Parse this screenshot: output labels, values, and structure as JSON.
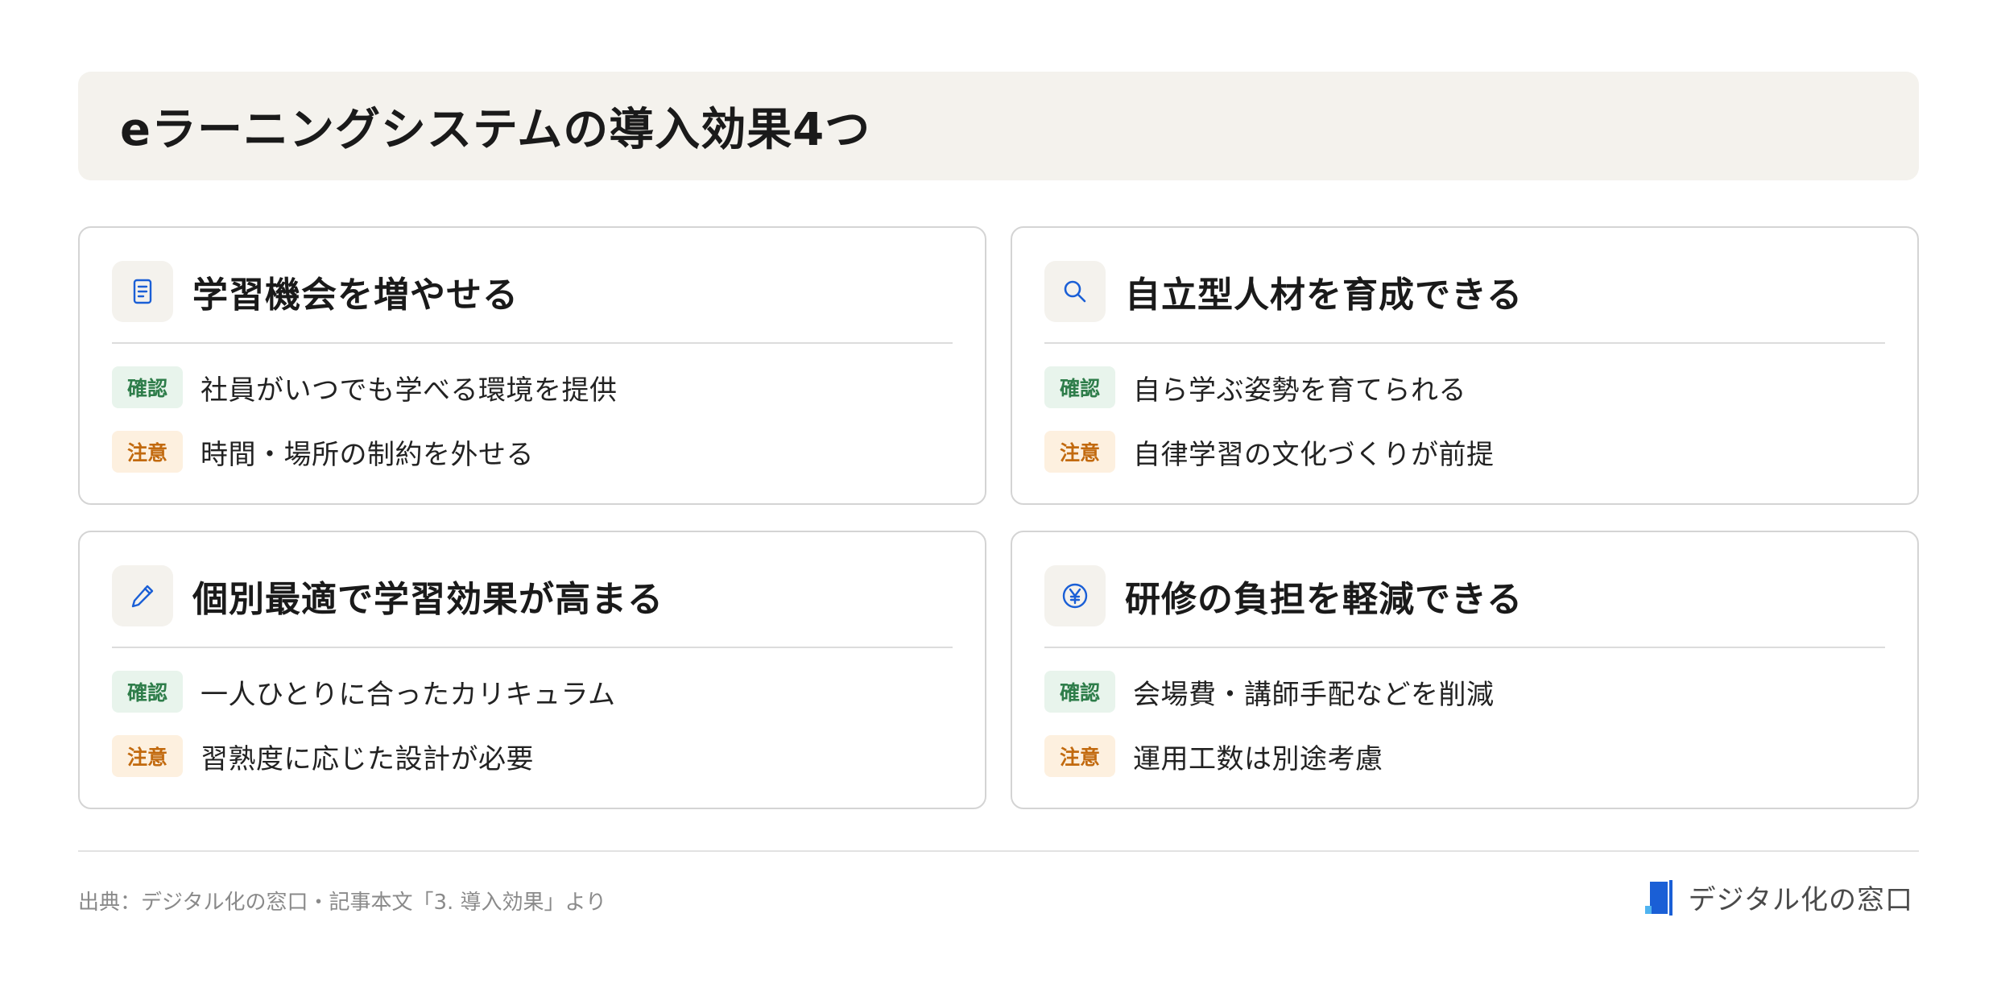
{
  "title": "eラーニングシステムの導入効果4つ",
  "badges": {
    "confirm": "確認",
    "caution": "注意"
  },
  "cards": [
    {
      "icon": "document-icon",
      "title": "学習機会を増やせる",
      "confirm": "社員がいつでも学べる環境を提供",
      "caution": "時間・場所の制約を外せる"
    },
    {
      "icon": "search-icon",
      "title": "自立型人材を育成できる",
      "confirm": "自ら学ぶ姿勢を育てられる",
      "caution": "自律学習の文化づくりが前提"
    },
    {
      "icon": "pencil-icon",
      "title": "個別最適で学習効果が高まる",
      "confirm": "一人ひとりに合ったカリキュラム",
      "caution": "習熟度に応じた設計が必要"
    },
    {
      "icon": "yen-icon",
      "title": "研修の負担を軽減できる",
      "confirm": "会場費・講師手配などを削減",
      "caution": "運用工数は別途考慮"
    }
  ],
  "footer": {
    "source": "出典：デジタル化の窓口・記事本文「3. 導入効果」より",
    "brand": "デジタル化の窓口"
  },
  "colors": {
    "accent": "#1a5fd6",
    "confirm_bg": "#e8f4ec",
    "confirm_fg": "#2e7d4a",
    "caution_bg": "#fdf0df",
    "caution_fg": "#c26a0f",
    "title_bg": "#f4f2ed"
  }
}
